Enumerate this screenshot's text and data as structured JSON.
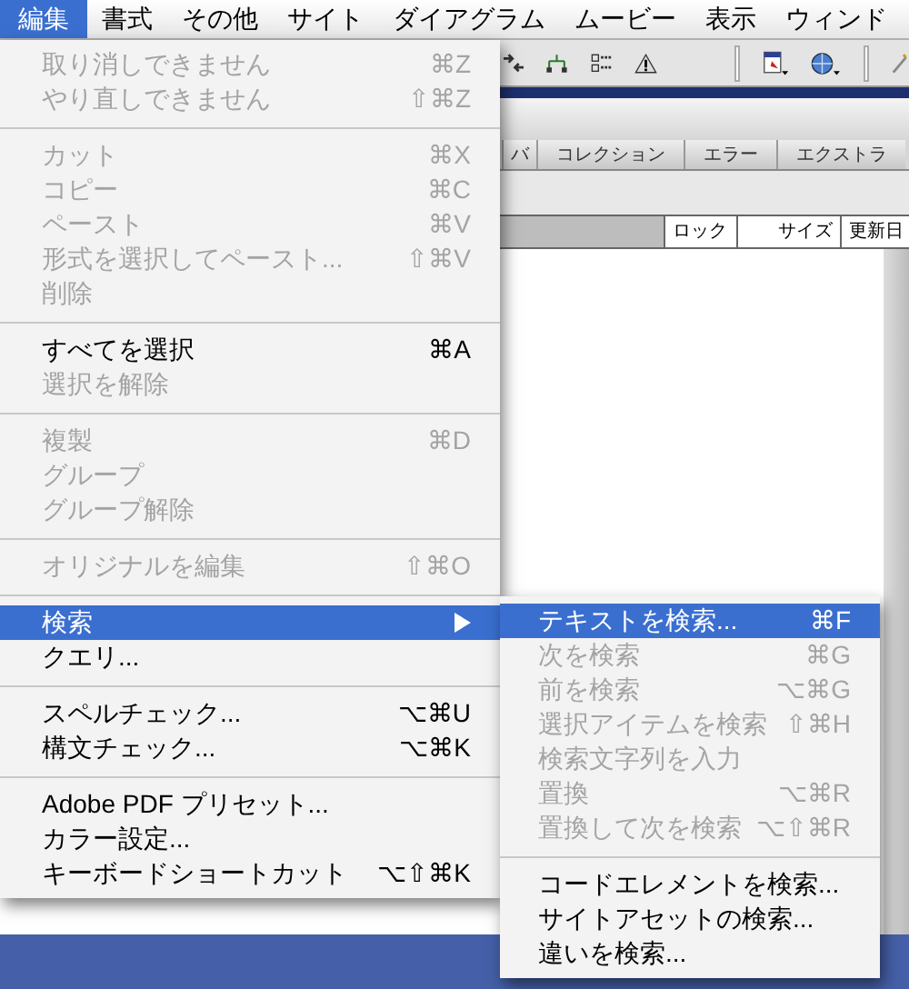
{
  "menu_bar": [
    {
      "label": "編集",
      "selected": true
    },
    {
      "label": "書式",
      "selected": false
    },
    {
      "label": "その他",
      "selected": false
    },
    {
      "label": "サイト",
      "selected": false
    },
    {
      "label": "ダイアグラム",
      "selected": false
    },
    {
      "label": "ムービー",
      "selected": false
    },
    {
      "label": "表示",
      "selected": false
    },
    {
      "label": "ウィンド",
      "selected": false
    }
  ],
  "edit_menu": [
    {
      "kind": "item",
      "label": "取り消しできません",
      "shortcut": "⌘Z",
      "disabled": true,
      "selected": false
    },
    {
      "kind": "item",
      "label": "やり直しできません",
      "shortcut": "⇧⌘Z",
      "disabled": true,
      "selected": false
    },
    {
      "kind": "separator"
    },
    {
      "kind": "item",
      "label": "カット",
      "shortcut": "⌘X",
      "disabled": true,
      "selected": false
    },
    {
      "kind": "item",
      "label": "コピー",
      "shortcut": "⌘C",
      "disabled": true,
      "selected": false
    },
    {
      "kind": "item",
      "label": "ペースト",
      "shortcut": "⌘V",
      "disabled": true,
      "selected": false
    },
    {
      "kind": "item",
      "label": "形式を選択してペースト...",
      "shortcut": "⇧⌘V",
      "disabled": true,
      "selected": false
    },
    {
      "kind": "item",
      "label": "削除",
      "disabled": true,
      "selected": false
    },
    {
      "kind": "separator"
    },
    {
      "kind": "item",
      "label": "すべてを選択",
      "shortcut": "⌘A",
      "disabled": false,
      "selected": false
    },
    {
      "kind": "item",
      "label": "選択を解除",
      "disabled": true,
      "selected": false
    },
    {
      "kind": "separator"
    },
    {
      "kind": "item",
      "label": "複製",
      "shortcut": "⌘D",
      "disabled": true,
      "selected": false
    },
    {
      "kind": "item",
      "label": "グループ",
      "disabled": true,
      "selected": false
    },
    {
      "kind": "item",
      "label": "グループ解除",
      "disabled": true,
      "selected": false
    },
    {
      "kind": "separator"
    },
    {
      "kind": "item",
      "label": "オリジナルを編集",
      "shortcut": "⇧⌘O",
      "disabled": true,
      "selected": false
    },
    {
      "kind": "separator"
    },
    {
      "kind": "submenu",
      "label": "検索",
      "disabled": false,
      "selected": true
    },
    {
      "kind": "item",
      "label": "クエリ...",
      "disabled": false,
      "selected": false
    },
    {
      "kind": "separator"
    },
    {
      "kind": "item",
      "label": "スペルチェック...",
      "shortcut": "⌥⌘U",
      "disabled": false,
      "selected": false
    },
    {
      "kind": "item",
      "label": "構文チェック...",
      "shortcut": "⌥⌘K",
      "disabled": false,
      "selected": false
    },
    {
      "kind": "separator"
    },
    {
      "kind": "item",
      "label": "Adobe PDF プリセット...",
      "disabled": false,
      "selected": false
    },
    {
      "kind": "item",
      "label": "カラー設定...",
      "disabled": false,
      "selected": false
    },
    {
      "kind": "item",
      "label": "キーボードショートカット",
      "shortcut": "⌥⇧⌘K",
      "disabled": false,
      "selected": false
    }
  ],
  "search_submenu": [
    {
      "kind": "item",
      "label": "テキストを検索...",
      "shortcut": "⌘F",
      "disabled": false,
      "selected": true
    },
    {
      "kind": "item",
      "label": "次を検索",
      "shortcut": "⌘G",
      "disabled": true,
      "selected": false
    },
    {
      "kind": "item",
      "label": "前を検索",
      "shortcut": "⌥⌘G",
      "disabled": true,
      "selected": false
    },
    {
      "kind": "item",
      "label": "選択アイテムを検索",
      "shortcut": "⇧⌘H",
      "disabled": true,
      "selected": false
    },
    {
      "kind": "item",
      "label": "検索文字列を入力",
      "disabled": true,
      "selected": false
    },
    {
      "kind": "item",
      "label": "置換",
      "shortcut": "⌥⌘R",
      "disabled": true,
      "selected": false
    },
    {
      "kind": "item",
      "label": "置換して次を検索",
      "shortcut": "⌥⇧⌘R",
      "disabled": true,
      "selected": false
    },
    {
      "kind": "separator"
    },
    {
      "kind": "item",
      "label": "コードエレメントを検索...",
      "disabled": false,
      "selected": false
    },
    {
      "kind": "item",
      "label": "サイトアセットの検索...",
      "disabled": false,
      "selected": false
    },
    {
      "kind": "item",
      "label": "違いを検索...",
      "disabled": false,
      "selected": false
    }
  ],
  "window": {
    "tabs": [
      "バ",
      "コレクション",
      "エラー",
      "エクストラ"
    ],
    "columns": [
      "ロック",
      "サイズ",
      "更新日"
    ]
  }
}
